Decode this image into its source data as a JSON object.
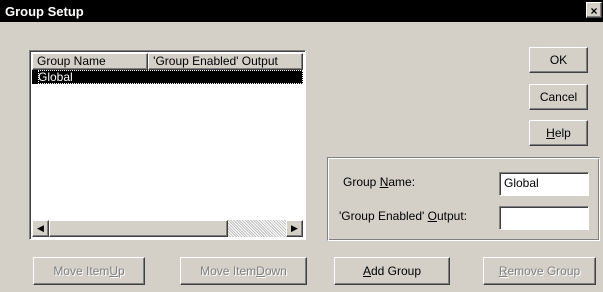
{
  "window": {
    "title": "Group Setup",
    "close_glyph": "×"
  },
  "list": {
    "columns": [
      "Group Name",
      "'Group Enabled' Output"
    ],
    "rows": [
      {
        "name": "Global",
        "output": ""
      }
    ],
    "scroll_left_glyph": "◀",
    "scroll_right_glyph": "▶"
  },
  "buttons": {
    "ok": "OK",
    "cancel": "Cancel",
    "help_mnemonic": "H",
    "help_rest": "elp",
    "move_up_pre": "Move Item ",
    "move_up_mnemonic": "U",
    "move_up_post": "p",
    "move_down_pre": "Move Item ",
    "move_down_mnemonic": "D",
    "move_down_post": "own",
    "add_mnemonic": "A",
    "add_rest": "dd Group",
    "remove_mnemonic": "R",
    "remove_rest": "emove Group"
  },
  "details": {
    "name_label_pre": "Group ",
    "name_label_mnemonic": "N",
    "name_label_post": "ame:",
    "name_value": "Global",
    "output_label_pre": "'Group Enabled' ",
    "output_label_mnemonic": "O",
    "output_label_post": "utput:",
    "output_value": ""
  },
  "icons": {
    "close": "close-icon",
    "scroll_left": "chevron-left-icon",
    "scroll_right": "chevron-right-icon"
  }
}
